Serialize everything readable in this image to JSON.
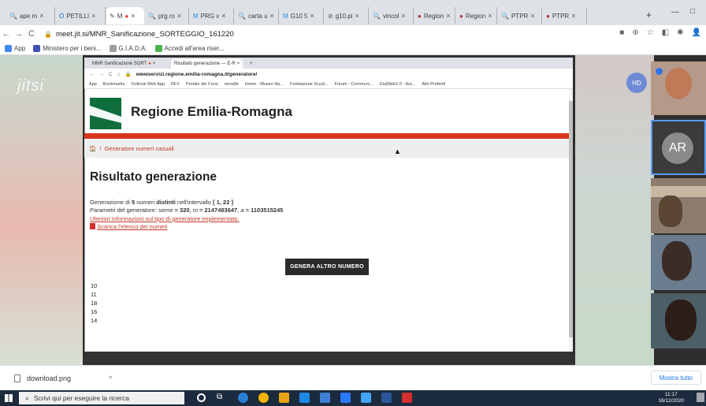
{
  "outer_tabs": [
    {
      "title": "ape m",
      "color": "#5f6368",
      "glyph": "🔍"
    },
    {
      "title": "PETILLI",
      "color": "#1565c0",
      "glyph": "O"
    },
    {
      "title": "M",
      "color": "#444",
      "glyph": "✎",
      "rec": true
    },
    {
      "title": "prg ro",
      "color": "#5f6368",
      "glyph": "🔍"
    },
    {
      "title": "PRG v",
      "color": "#1e88e5",
      "glyph": "M"
    },
    {
      "title": "carta u",
      "color": "#5f6368",
      "glyph": "🔍"
    },
    {
      "title": "G10 5",
      "color": "#1e88e5",
      "glyph": "M"
    },
    {
      "title": "g10.pi",
      "color": "#555",
      "glyph": "⊘"
    },
    {
      "title": "vincol",
      "color": "#5f6368",
      "glyph": "🔍"
    },
    {
      "title": "Region",
      "color": "#a33",
      "glyph": "●"
    },
    {
      "title": "Region",
      "color": "#a33",
      "glyph": "●"
    },
    {
      "title": "PTPR",
      "color": "#5f6368",
      "glyph": "🔍"
    },
    {
      "title": "PTPR",
      "color": "#a33",
      "glyph": "●"
    }
  ],
  "outer_url": "meet.jit.si/MNR_Sanificazione_SORTEGGIO_161220",
  "outer_bookmarks": [
    {
      "label": "App",
      "color": "#4285f4"
    },
    {
      "label": "Ministero per i beni...",
      "color": "#3f51b5"
    },
    {
      "label": "G.I.A.D.A.",
      "color": "#9e9e9e"
    },
    {
      "label": "Accedi all'area riser...",
      "color": "#4caf50"
    }
  ],
  "jitsi": {
    "logo": "jitsi",
    "hd_label": "HD",
    "avatar_initials": "AR"
  },
  "inner_tabs": [
    {
      "title": "MNR Sanificazione SORT"
    },
    {
      "title": "Risultato generazione — E-R"
    }
  ],
  "inner_url": "wwwservizi.regione.emilia-romagna.it/generatore/",
  "inner_bookmarks": [
    "App",
    "Bookmarks",
    "Outlook Web App",
    "RFV",
    "Portale dei Corsi",
    "moodle",
    "Home - Museo Na...",
    "Fondazione Scuol...",
    "Forum - Communi...",
    "GisjWeb2.0 - Aut...",
    "Altri Preferiti"
  ],
  "page": {
    "site_title": "Regione Emilia-Romagna",
    "breadcrumb": "Generatore numeri casuali",
    "heading": "Risultato generazione",
    "line1_pre": "Generazione di ",
    "line1_count": "5",
    "line1_mid": " numeri ",
    "line1_bold": "distinti",
    "line1_post": " nell'intervallo ",
    "line1_range": "[ 1, 22 ]",
    "line2_pre": "Parametri del generatore: ",
    "line2_seme_label": "seme",
    "line2_seme": " = 320",
    "line2_m_label": "m",
    "line2_m": " = 2147483647",
    "line2_a_label": "a",
    "line2_a": " = 1103515245",
    "link_info": "Ulteriori informazioni sul tipo di generatore implementato.",
    "link_download": "Scarica l'elenco dei numeri",
    "button": "GENERA ALTRO NUMERO",
    "numbers": [
      "10",
      "11",
      "18",
      "16",
      "14"
    ]
  },
  "download": {
    "file": "download.png",
    "show_all": "Mostra tutto"
  },
  "taskbar": {
    "search_placeholder": "Scrivi qui per eseguire la ricerca",
    "time": "11:17",
    "date": "16/12/2020"
  }
}
